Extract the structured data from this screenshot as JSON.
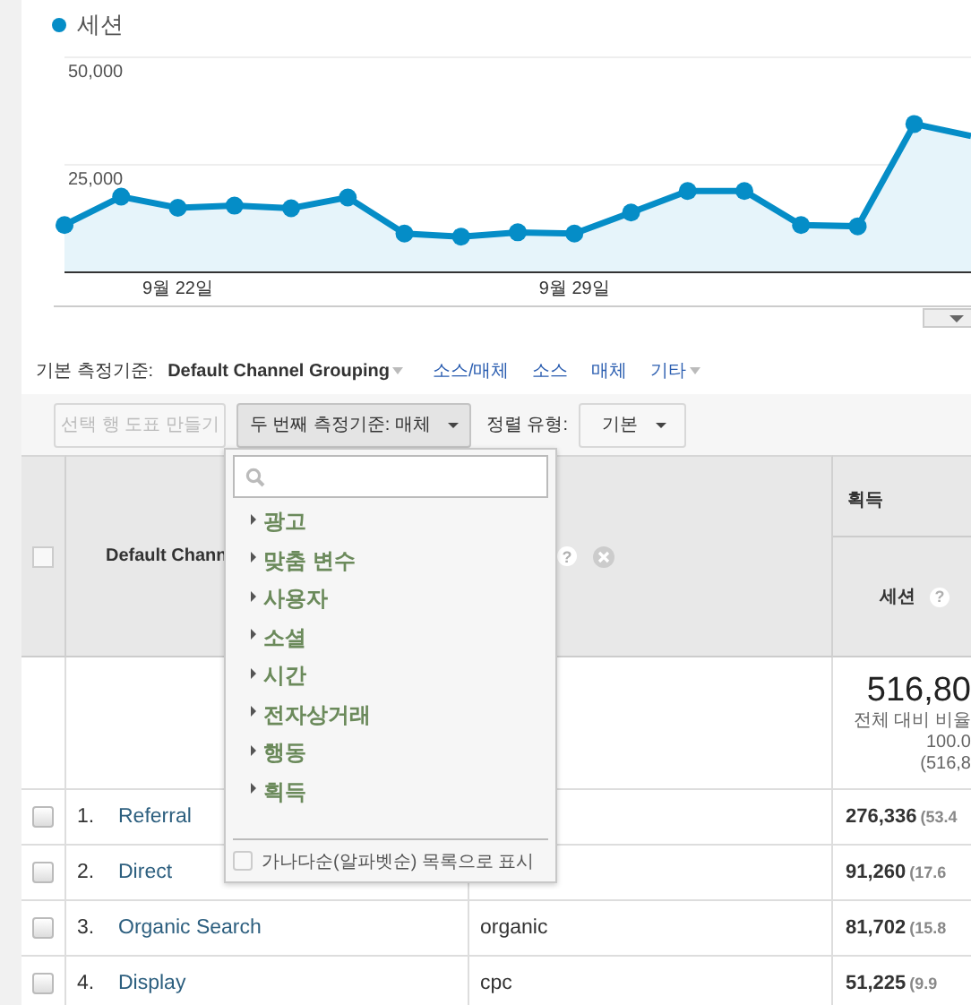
{
  "chart": {
    "chart_data": {
      "type": "area",
      "categories": [
        null,
        null,
        "9월 22일",
        null,
        null,
        null,
        null,
        null,
        null,
        "9월 29일",
        null,
        null,
        null,
        null,
        null,
        null,
        null
      ],
      "series": [
        {
          "name": "세션",
          "color": "#058dc7",
          "values": [
            11000,
            17600,
            15000,
            15500,
            14900,
            17400,
            9000,
            8300,
            9300,
            9000,
            13900,
            18900,
            18900,
            11000,
            10700,
            34500,
            31700
          ]
        }
      ],
      "ylim": [
        0,
        50000
      ],
      "yticks": [
        {
          "value": 25000,
          "label": "25,000"
        },
        {
          "value": 50000,
          "label": "50,000"
        }
      ]
    }
  },
  "dimension_bar": {
    "label": "기본 측정기준:",
    "primary": "Default Channel Grouping",
    "links": [
      "소스/매체",
      "소스",
      "매체"
    ],
    "more": "기타"
  },
  "toolbar": {
    "chart_button": {
      "label": "선택 행 도표 만들기",
      "disabled": true
    },
    "secondary_button": {
      "label": "두 번째 측정기준: 매체",
      "pressed": true
    },
    "sort_label": "정렬 유형:",
    "sort_button": "기본"
  },
  "dropdown": {
    "items": [
      "광고",
      "맞춤 변수",
      "사용자",
      "소셜",
      "시간",
      "전자상거래",
      "행동",
      "획득"
    ],
    "alphabetical": {
      "label": "가나다순(알파벳순) 목록으로 표시",
      "checked": false
    }
  },
  "table": {
    "header_checkbox": {
      "checked": false
    },
    "column_1": "Default Chann",
    "column_2_help": "?",
    "group": "획득",
    "sessions_header": "세션",
    "sessions_help": "?",
    "total": {
      "value": "516,80",
      "label": "전체 대비 비율",
      "percent": "100.0",
      "paren": "(516,8"
    },
    "rows": [
      {
        "index": "1.",
        "name": "Referral",
        "sessions": "276,336",
        "share": "(53.4",
        "checked": false
      },
      {
        "index": "2.",
        "name": "Direct",
        "sessions": "91,260",
        "share": "(17.6",
        "checked": false
      },
      {
        "index": "3.",
        "name": "Organic Search",
        "medium": "organic",
        "sessions": "81,702",
        "share": "(15.8",
        "checked": false
      },
      {
        "index": "4.",
        "name": "Display",
        "medium": "cpc",
        "sessions": "51,225",
        "share": "(9.9",
        "checked": false
      }
    ]
  }
}
